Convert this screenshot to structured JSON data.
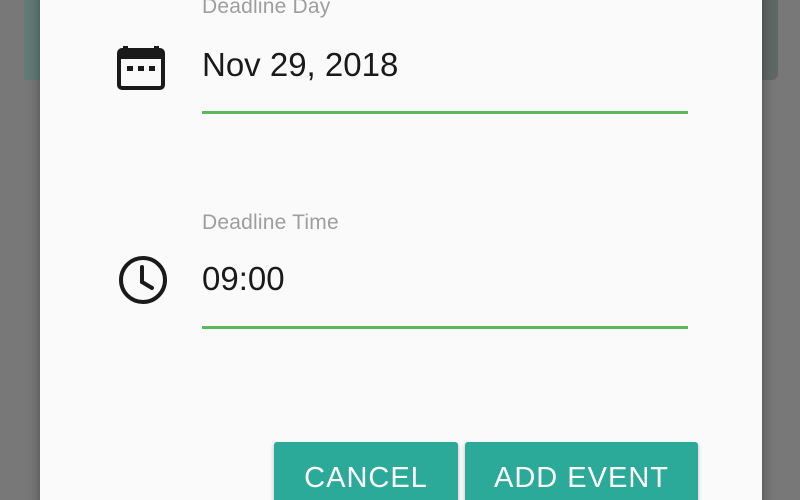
{
  "dialog": {
    "deadline_day": {
      "label": "Deadline Day",
      "value": "Nov 29, 2018",
      "icon": "calendar-icon"
    },
    "deadline_time": {
      "label": "Deadline Time",
      "value": "09:00",
      "icon": "clock-icon"
    },
    "buttons": {
      "cancel_label": "CANCEL",
      "add_event_label": "ADD EVENT"
    }
  },
  "colors": {
    "accent_button": "#2baa9a",
    "underline": "#5cb85c",
    "dialog_background": "#fafafa",
    "scrim": "#777777",
    "background_card": "#1a3b36"
  }
}
